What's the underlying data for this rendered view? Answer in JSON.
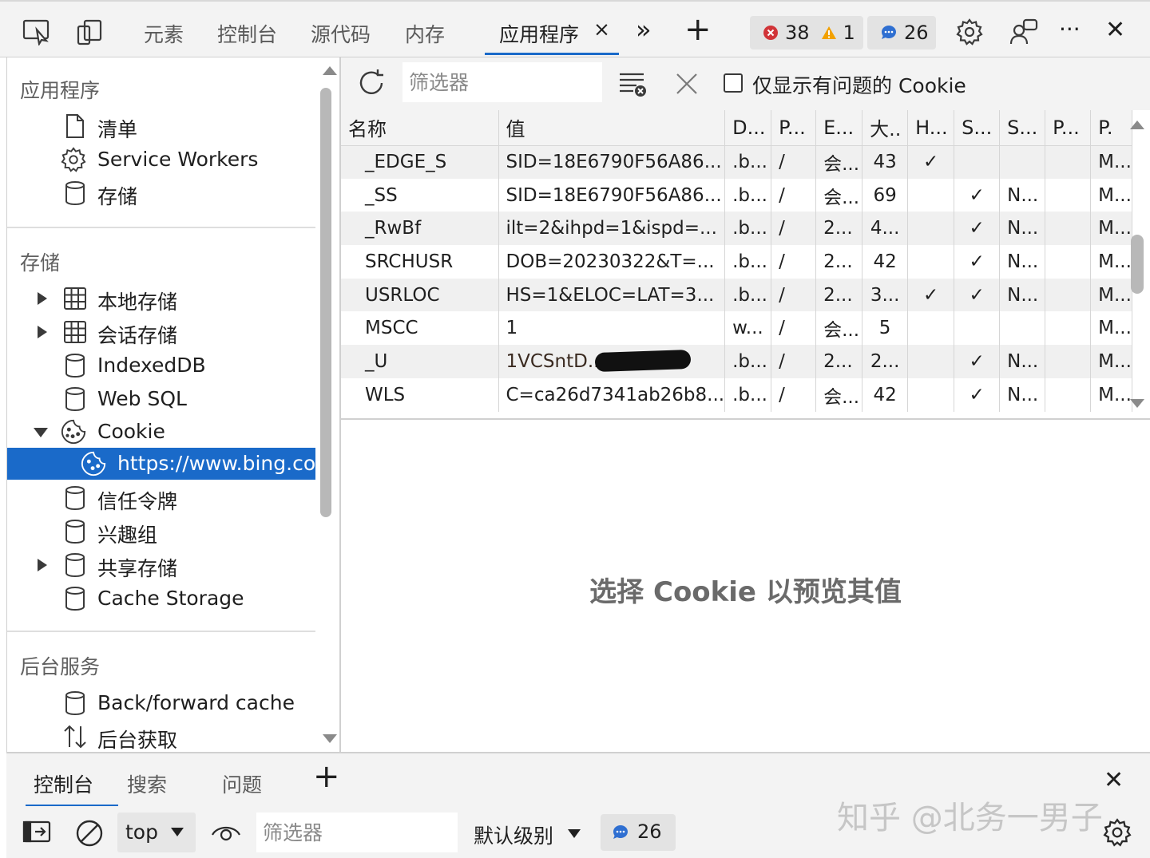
{
  "toolbar": {
    "tabs": [
      "元素",
      "控制台",
      "源代码",
      "内存",
      "应用程序"
    ],
    "active_tab": "应用程序",
    "close_glyph": "×",
    "more_tabs_glyph": "»",
    "add_glyph": "+",
    "errors_count": "38",
    "warnings_count": "1",
    "messages_count": "26",
    "more_glyph": "···",
    "close_devtools_glyph": "✕"
  },
  "sidebar": {
    "sections": [
      {
        "title": "应用程序",
        "items": [
          {
            "label": "清单",
            "icon": "file-icon"
          },
          {
            "label": "Service Workers",
            "icon": "gear-icon"
          },
          {
            "label": "存储",
            "icon": "database-icon"
          }
        ]
      },
      {
        "title": "存储",
        "items": [
          {
            "label": "本地存储",
            "icon": "grid-icon",
            "expander": "collapsed"
          },
          {
            "label": "会话存储",
            "icon": "grid-icon",
            "expander": "collapsed"
          },
          {
            "label": "IndexedDB",
            "icon": "database-icon"
          },
          {
            "label": "Web SQL",
            "icon": "database-icon"
          },
          {
            "label": "Cookie",
            "icon": "cookie-icon",
            "expander": "expanded"
          },
          {
            "label": "https://www.bing.com",
            "icon": "cookie-icon",
            "selected": true
          },
          {
            "label": "信任令牌",
            "icon": "database-icon"
          },
          {
            "label": "兴趣组",
            "icon": "database-icon"
          },
          {
            "label": "共享存储",
            "icon": "database-icon",
            "expander": "collapsed"
          },
          {
            "label": "Cache Storage",
            "icon": "database-icon"
          }
        ]
      },
      {
        "title": "后台服务",
        "items": [
          {
            "label": "Back/forward cache",
            "icon": "database-icon"
          },
          {
            "label": "后台获取",
            "icon": "sync-arrows-icon"
          }
        ]
      }
    ]
  },
  "cookies": {
    "filter_placeholder": "筛选器",
    "only_issues_label": "仅显示有问题的 Cookie",
    "columns": [
      "名称",
      "值",
      "D...",
      "P...",
      "E...",
      "大..",
      "H...",
      "S...",
      "S...",
      "P...",
      "P."
    ],
    "rows": [
      [
        "_EDGE_S",
        "SID=18E6790F56A86...",
        ".b...",
        "/",
        "会...",
        "43",
        "✓",
        "",
        "",
        "",
        "M..."
      ],
      [
        "_SS",
        "SID=18E6790F56A86...",
        ".b...",
        "/",
        "会...",
        "69",
        "",
        "✓",
        "N...",
        "",
        "M..."
      ],
      [
        "_RwBf",
        "ilt=2&ihpd=1&ispd=...",
        ".b...",
        "/",
        "2...",
        "4...",
        "",
        "✓",
        "N...",
        "",
        "M..."
      ],
      [
        "SRCHUSR",
        "DOB=20230322&T=...",
        ".b...",
        "/",
        "2...",
        "42",
        "",
        "✓",
        "N...",
        "",
        "M..."
      ],
      [
        "USRLOC",
        "HS=1&ELOC=LAT=3...",
        ".b...",
        "/",
        "2...",
        "3...",
        "✓",
        "✓",
        "N...",
        "",
        "M..."
      ],
      [
        "MSCC",
        "1",
        "w...",
        "/",
        "会...",
        "5",
        "",
        "",
        "",
        "",
        "M..."
      ],
      [
        "_U",
        "1VCSntD...",
        ".b...",
        "/",
        "2...",
        "2...",
        "",
        "✓",
        "N...",
        "",
        "M..."
      ],
      [
        "WLS",
        "C=ca26d7341ab26b8...",
        ".b...",
        "/",
        "会...",
        "42",
        "",
        "✓",
        "N...",
        "",
        "M..."
      ]
    ],
    "preview_message": "选择 Cookie 以预览其值"
  },
  "drawer": {
    "tabs": [
      "控制台",
      "搜索",
      "问题"
    ],
    "active_tab": "控制台",
    "context_value": "top",
    "filter_placeholder": "筛选器",
    "level_label": "默认级别",
    "messages_count": "26"
  },
  "watermark": "知乎 @北务一男子",
  "colors": {
    "accent": "#1a6ac9",
    "error": "#d13438",
    "warning": "#f2a100",
    "message": "#2f6fd1",
    "redaction": "#f25d0a"
  }
}
